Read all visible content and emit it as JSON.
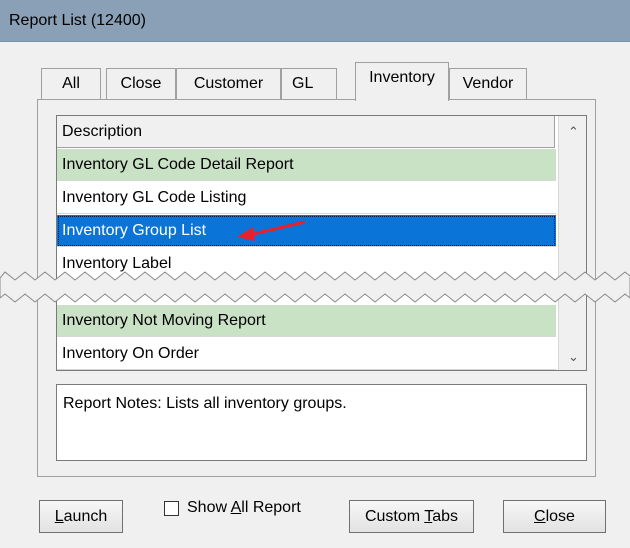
{
  "window": {
    "title": "Report List (12400)"
  },
  "tabs": [
    {
      "label": "All"
    },
    {
      "label": "Close"
    },
    {
      "label": "Customer"
    },
    {
      "label": "GL"
    },
    {
      "label": "Inventory"
    },
    {
      "label": "Vendor"
    }
  ],
  "active_tab": "Inventory",
  "list": {
    "header": "Description",
    "rows": [
      {
        "label": "Inventory GL Code Detail Report",
        "style": "green"
      },
      {
        "label": "Inventory GL Code Listing",
        "style": "white"
      },
      {
        "label": "Inventory Group List",
        "style": "selected"
      },
      {
        "label": "Inventory Label",
        "style": "white"
      },
      {
        "label": "Inventory Not Moving Report",
        "style": "green"
      },
      {
        "label": "Inventory On Order",
        "style": "white"
      }
    ]
  },
  "scroll": {
    "up_icon": "chevron-up",
    "down_icon": "chevron-down"
  },
  "notes": {
    "text": "Report Notes:  Lists all inventory groups."
  },
  "buttons": {
    "launch": {
      "prefix": "",
      "accel": "L",
      "suffix": "aunch"
    },
    "show_all": {
      "prefix": "Show ",
      "accel": "A",
      "suffix": "ll Report"
    },
    "custom_tabs": {
      "prefix": "Custom ",
      "accel": "T",
      "suffix": "abs"
    },
    "close": {
      "prefix": "",
      "accel": "C",
      "suffix": "lose"
    }
  },
  "annotation": {
    "arrow_color": "#e8202a"
  }
}
